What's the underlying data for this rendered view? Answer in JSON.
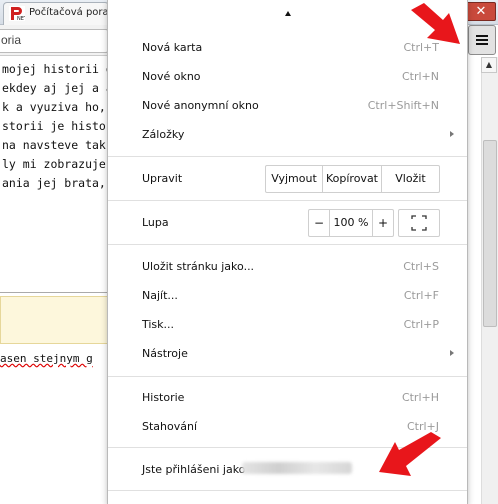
{
  "browser": {
    "tab_title": "Počítačová pora",
    "close_glyph": "✕",
    "omnibox_text": "oria"
  },
  "page": {
    "lines": [
      " mojej historii go",
      "ekdey aj jej a al",
      "k a vyuziva ho, n",
      "storii je historia n",
      "na navsteve tak",
      "ly mi zobrazuje j",
      "ania jej brata, vs"
    ],
    "bottom_text": "asen stejnym g"
  },
  "menu": {
    "items": [
      {
        "label": "Nová karta",
        "shortcut": "Ctrl+T"
      },
      {
        "label": "Nové okno",
        "shortcut": "Ctrl+N"
      },
      {
        "label": "Nové anonymní okno",
        "shortcut": "Ctrl+Shift+N"
      },
      {
        "label": "Záložky",
        "shortcut": ""
      }
    ],
    "edit": {
      "label": "Upravit",
      "cut": "Vyjmout",
      "copy": "Kopírovat",
      "paste": "Vložit"
    },
    "zoom": {
      "label": "Lupa",
      "minus": "−",
      "value": "100 %",
      "plus": "+"
    },
    "items2": [
      {
        "label": "Uložit stránku jako...",
        "shortcut": "Ctrl+S"
      },
      {
        "label": "Najít...",
        "shortcut": "Ctrl+F"
      },
      {
        "label": "Tisk...",
        "shortcut": "Ctrl+P"
      },
      {
        "label": "Nástroje",
        "shortcut": ""
      }
    ],
    "items3": [
      {
        "label": "Historie",
        "shortcut": "Ctrl+H"
      },
      {
        "label": "Stahování",
        "shortcut": "Ctrl+J"
      }
    ],
    "signed_in_label": "Jste přihlášeni jako"
  },
  "colors": {
    "arrow_red": "#e8161b",
    "close_red": "#c94a3c"
  }
}
